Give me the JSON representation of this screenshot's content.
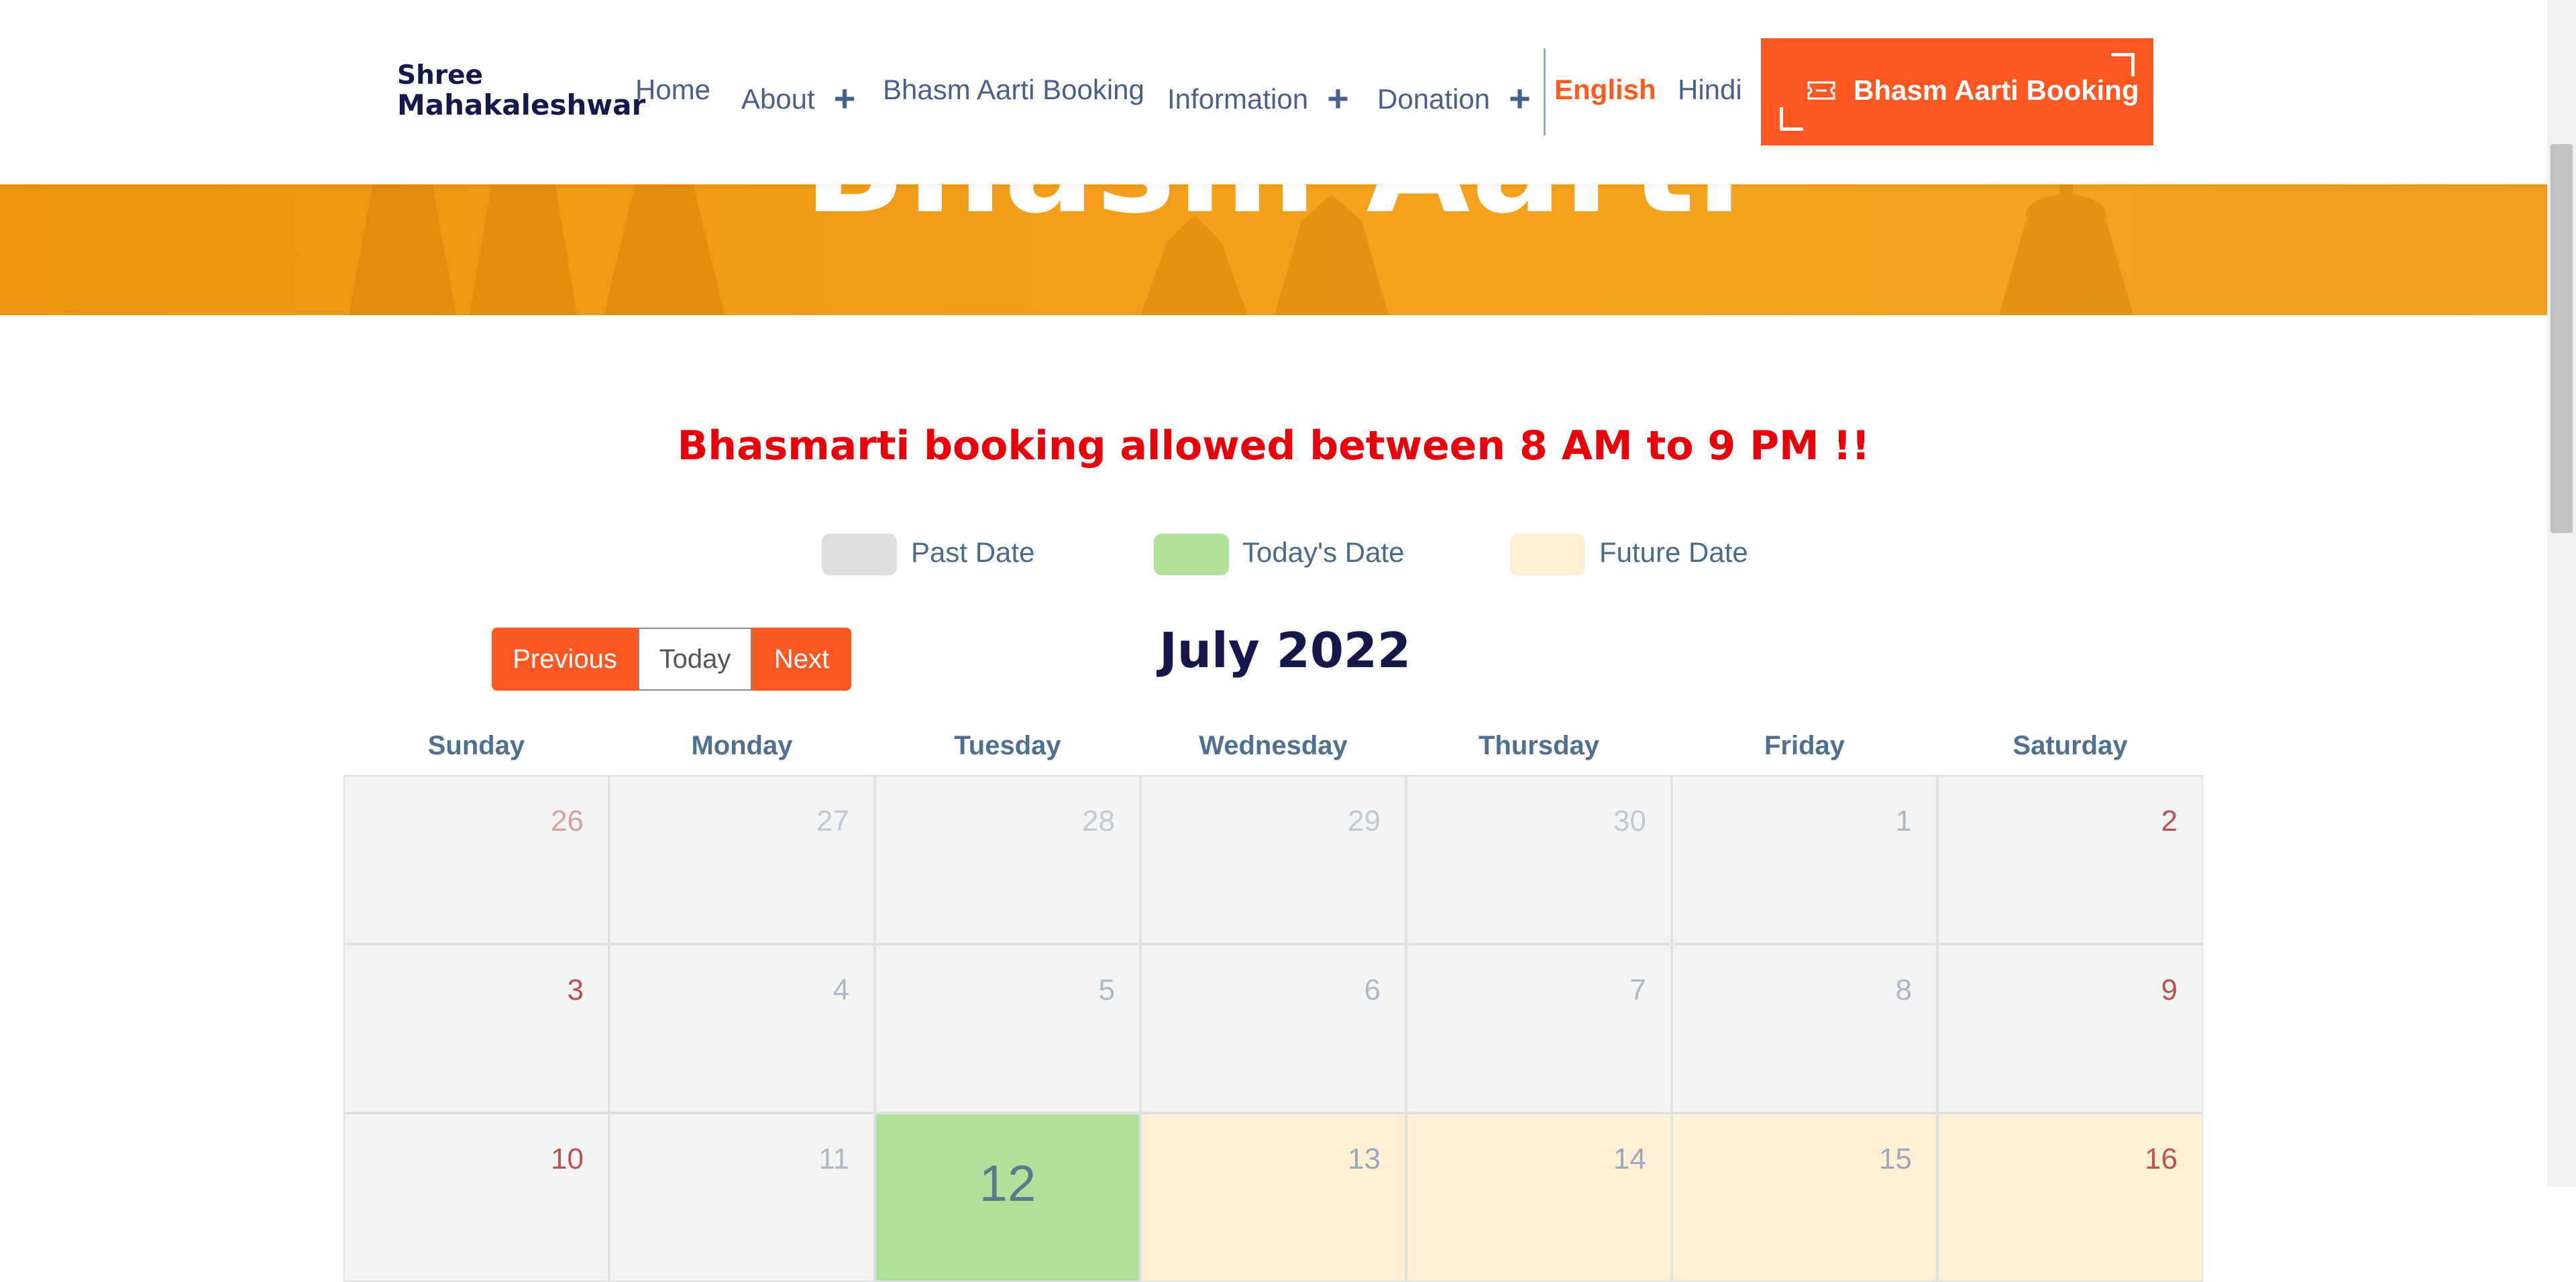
{
  "hero": {
    "title": "Bhasm Aarti"
  },
  "header": {
    "logo": {
      "line1": "Shree",
      "line2": "Mahakaleshwar"
    },
    "nav": [
      {
        "label": "Home"
      },
      {
        "label": "About"
      },
      {
        "label": "Bhasm Aarti Booking"
      },
      {
        "label": "Information"
      },
      {
        "label": "Donation"
      }
    ],
    "plus_symbol": "+",
    "languages": {
      "english": "English",
      "hindi": "Hindi"
    },
    "cta": {
      "label": "Bhasm Aarti Booking",
      "icon": "ticket-icon"
    }
  },
  "notice": "Bhasmarti booking allowed between 8 AM to 9 PM !!",
  "legend": [
    {
      "label": "Past Date",
      "color": "#dedede"
    },
    {
      "label": "Today's Date",
      "color": "#b0e09a"
    },
    {
      "label": "Future Date",
      "color": "#fef0d6"
    }
  ],
  "toolbar": {
    "previous": "Previous",
    "today": "Today",
    "next": "Next"
  },
  "calendar": {
    "month_title": "July 2022",
    "weekdays": [
      "Sunday",
      "Monday",
      "Tuesday",
      "Wednesday",
      "Thursday",
      "Friday",
      "Saturday"
    ],
    "weeks": [
      [
        "26",
        "27",
        "28",
        "29",
        "30",
        "1",
        "2"
      ],
      [
        "3",
        "4",
        "5",
        "6",
        "7",
        "8",
        "9"
      ],
      [
        "10",
        "11",
        "12",
        "13",
        "14",
        "15",
        "16"
      ]
    ],
    "today": "12"
  },
  "colors": {
    "accent": "#ff5722",
    "notice": "#e8000b",
    "navy": "#14184a",
    "past": "#f4f4f4",
    "today": "#b0e09a",
    "future": "#fef0d6"
  }
}
